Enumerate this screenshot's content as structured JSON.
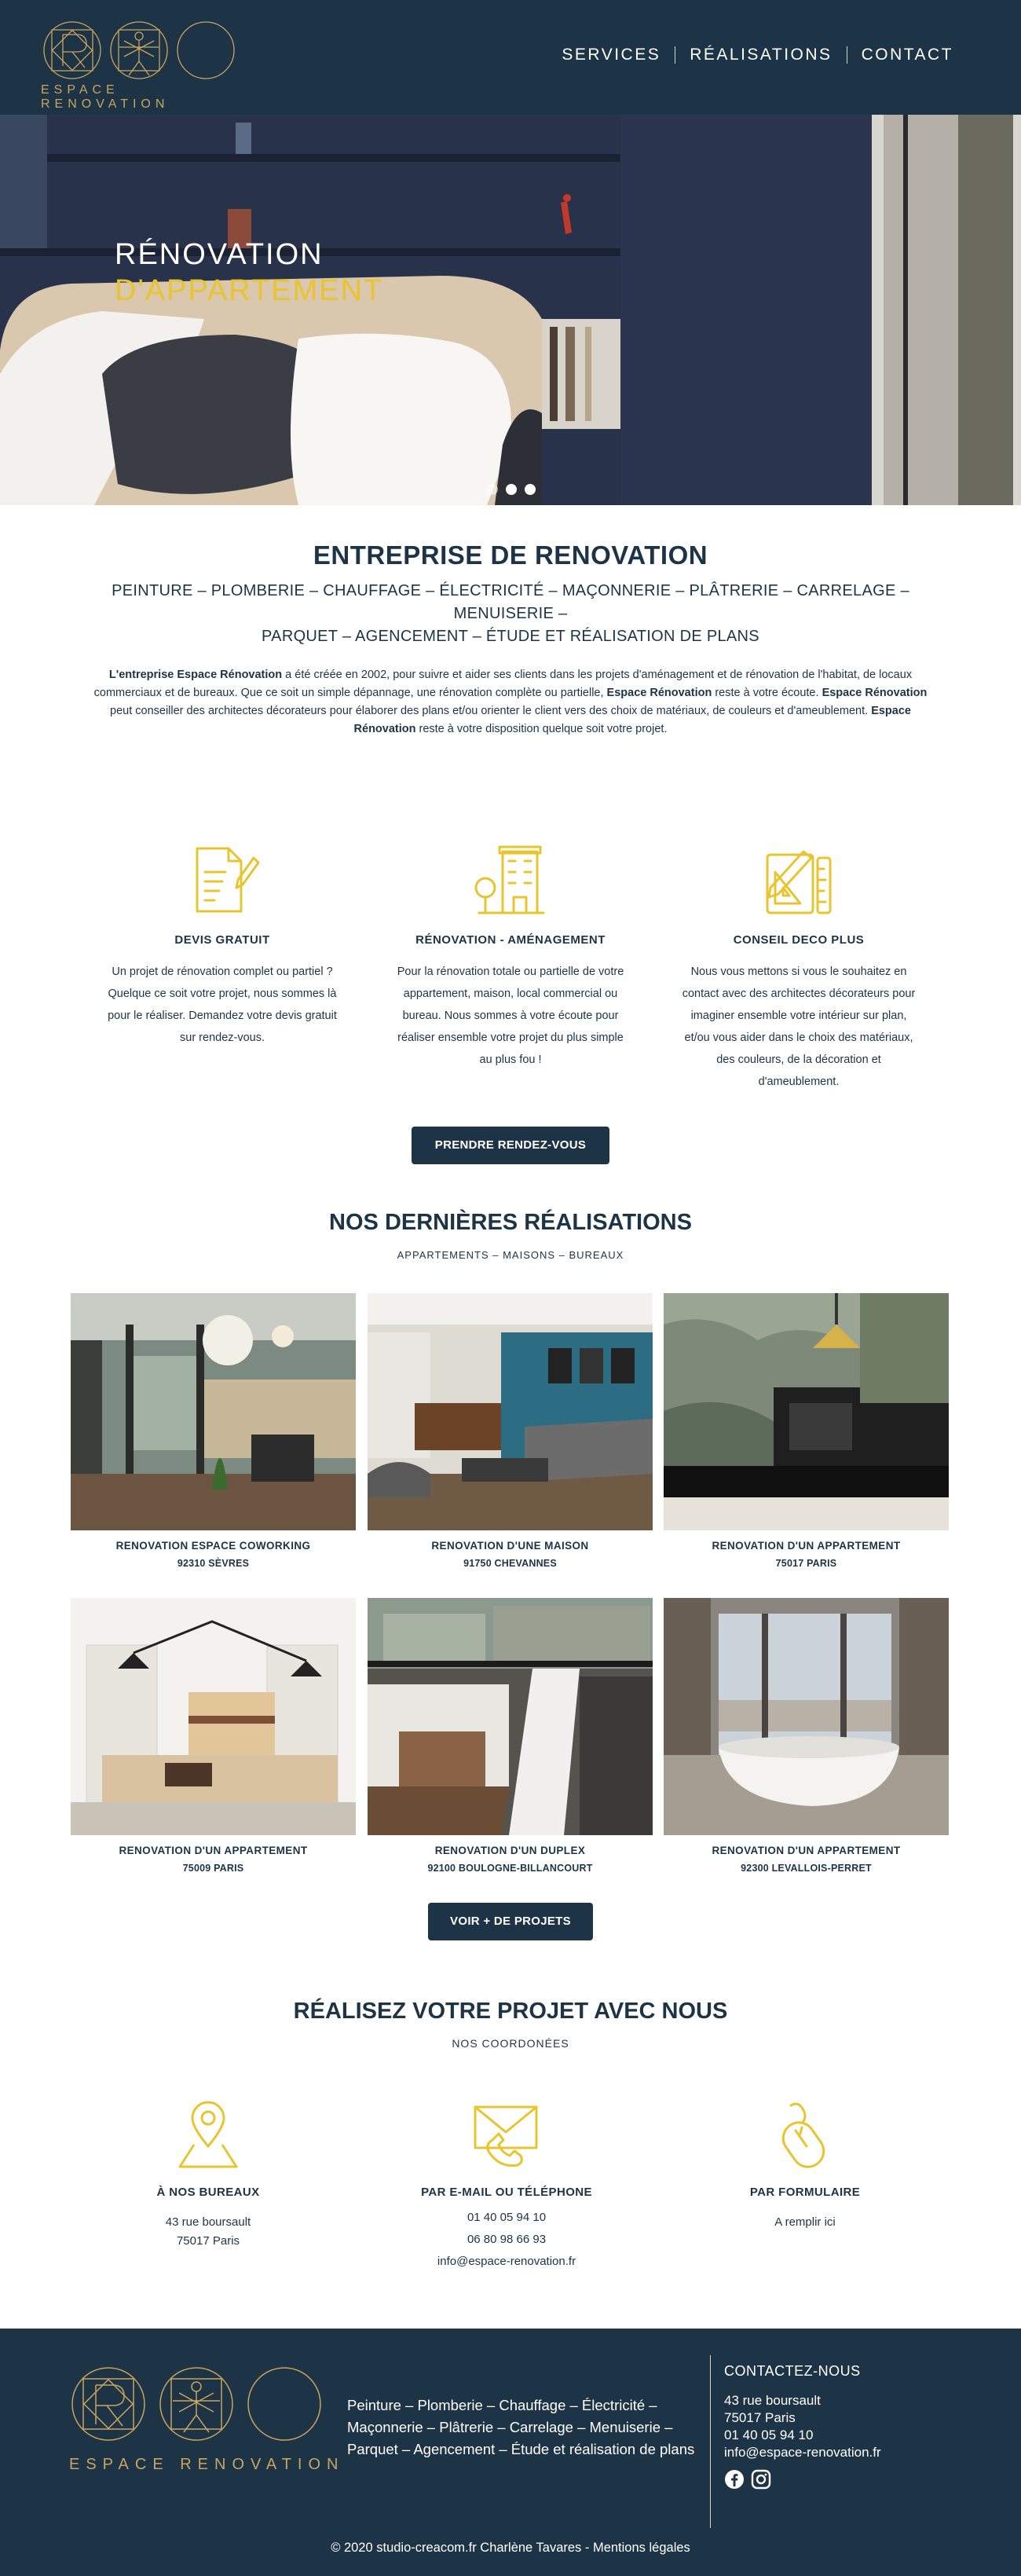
{
  "header": {
    "logo_text": "ESPACE RENOVATION",
    "nav": [
      "SERVICES",
      "RÉALISATIONS",
      "CONTACT"
    ]
  },
  "hero": {
    "title_line1": "RÉNOVATION",
    "title_line2": "D'APPARTEMENT",
    "slides": 3,
    "active_slide": 2
  },
  "intro": {
    "title": "ENTREPRISE DE RENOVATION",
    "subtitle_line1": "PEINTURE – PLOMBERIE – CHAUFFAGE – ÉLECTRICITÉ – MAÇONNERIE – PLÂTRERIE – CARRELAGE – MENUISERIE –",
    "subtitle_line2": "PARQUET – AGENCEMENT – ÉTUDE ET RÉALISATION DE PLANS",
    "body": {
      "b1": "L'entreprise Espace Rénovation",
      "t1": " a été créée en 2002, pour suivre et aider ses clients dans les projets d'aménagement et de rénovation de l'habitat, de locaux commerciaux et de bureaux. Que ce soit un simple dépannage, une rénovation complète ou partielle, ",
      "b2": "Espace Rénovation",
      "t2": " reste à votre écoute. ",
      "b3": "Espace Rénovation",
      "t3": " peut conseiller des architectes décorateurs pour élaborer des plans et/ou orienter le client vers des choix de matériaux, de couleurs et d'ameublement. ",
      "b4": "Espace Rénovation",
      "t4": " reste à votre disposition quelque soit votre projet."
    }
  },
  "features": [
    {
      "icon": "quote-document-icon",
      "title": "DEVIS GRATUIT",
      "lines": [
        "Un projet de rénovation complet ou partiel ?",
        "Quelque ce soit votre projet, nous sommes là",
        "pour le réaliser. Demandez votre devis gratuit",
        "sur rendez-vous."
      ]
    },
    {
      "icon": "building-icon",
      "title": "RÉNOVATION - AMÉNAGEMENT",
      "lines": [
        "Pour la rénovation totale ou partielle de votre",
        "appartement, maison, local commercial ou",
        "bureau. Nous sommes à votre écoute pour",
        "réaliser ensemble votre projet du plus simple",
        "au plus fou !"
      ]
    },
    {
      "icon": "design-tools-icon",
      "title": "CONSEIL DECO PLUS",
      "lines": [
        "Nous vous mettons si vous le souhaitez en",
        "contact avec des architectes décorateurs pour",
        "imaginer ensemble votre intérieur sur plan,",
        "et/ou vous aider dans le choix des matériaux,",
        "des couleurs, de la décoration et",
        "d'ameublement."
      ]
    }
  ],
  "cta_rdv": "PRENDRE RENDEZ-VOUS",
  "realisations": {
    "title": "NOS DERNIÈRES RÉALISATIONS",
    "subtitle": "APPARTEMENTS – MAISONS – BUREAUX",
    "projects": [
      {
        "title": "RENOVATION ESPACE COWORKING",
        "location": "92310 SÈVRES"
      },
      {
        "title": "RENOVATION D'UNE MAISON",
        "location": "91750 CHEVANNES"
      },
      {
        "title": "RENOVATION D'UN APPARTEMENT",
        "location": "75017 PARIS"
      },
      {
        "title": "RENOVATION D'UN APPARTEMENT",
        "location": "75009 PARIS"
      },
      {
        "title": "RENOVATION D'UN DUPLEX",
        "location": "92100 BOULOGNE-BILLANCOURT"
      },
      {
        "title": "RENOVATION D'UN APPARTEMENT",
        "location": "92300 LEVALLOIS-PERRET"
      }
    ],
    "more_button": "VOIR + DE PROJETS"
  },
  "contact": {
    "title": "RÉALISEZ VOTRE PROJET AVEC NOUS",
    "subtitle": "NOS COORDONÉES",
    "blocks": [
      {
        "icon": "map-pin-icon",
        "title": "À NOS BUREAUX",
        "lines": [
          "43 rue boursault",
          "75017 Paris"
        ]
      },
      {
        "icon": "mail-phone-icon",
        "title": "PAR E-MAIL OU TÉLÉPHONE",
        "lines": [
          "01 40 05 94 10",
          "06 80 98 66 93",
          "info@espace-renovation.fr"
        ]
      },
      {
        "icon": "mouse-icon",
        "title": "PAR FORMULAIRE",
        "lines": [
          "A remplir ici"
        ]
      }
    ]
  },
  "footer": {
    "logo_text": "ESPACE RENOVATION",
    "services_line1": "Peinture – Plomberie – Chauffage – Électricité –",
    "services_line2": "Maçonnerie – Plâtrerie – Carrelage – Menuiserie –",
    "services_line3": "Parquet – Agencement – Étude et réalisation de plans",
    "contact_title": "CONTACTEZ-NOUS",
    "contact_lines": [
      "43 rue boursault",
      "75017 Paris",
      "01 40 05 94 10",
      "info@espace-renovation.fr"
    ],
    "copyright": "© 2020 studio-creacom.fr Charlène Tavares - Mentions légales"
  },
  "colors": {
    "navy": "#1d3447",
    "gold": "#e8c42e",
    "logo_gold": "#c9a45c"
  }
}
